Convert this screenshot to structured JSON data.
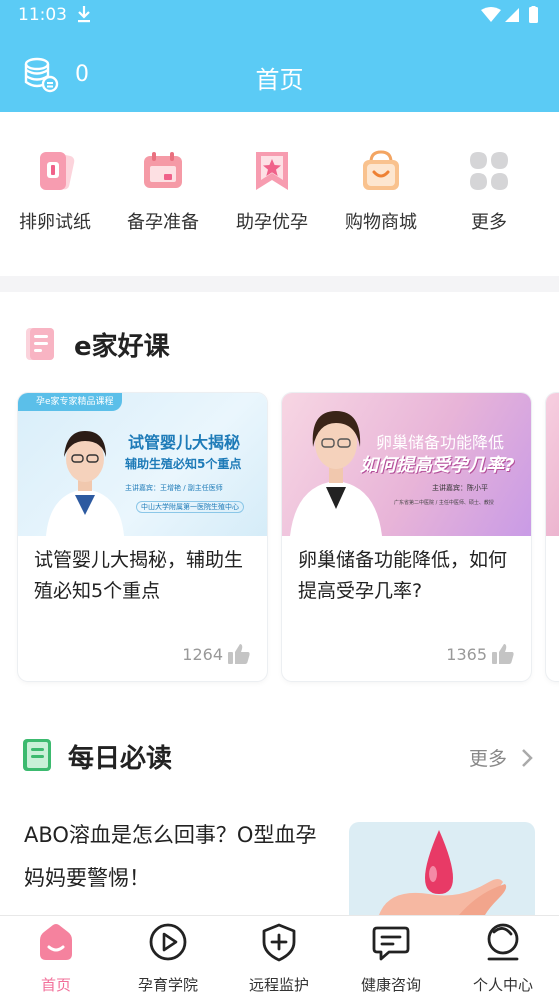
{
  "status_bar": {
    "time": "11:03"
  },
  "header": {
    "coin_count": "0",
    "title": "首页"
  },
  "quick_menu": [
    {
      "label": "排卵试纸",
      "icon": "ovulation-strip-icon"
    },
    {
      "label": "备孕准备",
      "icon": "calendar-icon"
    },
    {
      "label": "助孕优孕",
      "icon": "star-ribbon-icon"
    },
    {
      "label": "购物商城",
      "icon": "shopping-bag-icon"
    },
    {
      "label": "更多",
      "icon": "more-grid-icon"
    }
  ],
  "course_section": {
    "title": "e家好课",
    "cards": [
      {
        "badge": "孕e家专家精品课程",
        "banner_title": "试管婴儿大揭秘",
        "banner_sub": "辅助生殖必知5个重点",
        "banner_host": "主讲嘉宾：王增艳 / 副主任医师",
        "banner_org": "中山大学附属第一医院生殖中心",
        "title": "试管婴儿大揭秘，辅助生殖必知5个重点",
        "likes": "1264"
      },
      {
        "banner_title": "卵巢储备功能降低",
        "banner_sub": "如何提高受孕几率?",
        "banner_host": "主讲嘉宾：陈小平",
        "banner_org": "广东省第二中医院 / 主任中医师、硕士、教授",
        "title": "卵巢储备功能降低，如何提高受孕几率?",
        "likes": "1365"
      }
    ]
  },
  "daily_section": {
    "title": "每日必读",
    "more_label": "更多",
    "article_title": "ABO溶血是怎么回事？O型血孕妈妈要警惕！"
  },
  "bottom_nav": [
    {
      "label": "首页",
      "icon": "home-icon",
      "active": true
    },
    {
      "label": "孕育学院",
      "icon": "play-circle-icon",
      "active": false
    },
    {
      "label": "远程监护",
      "icon": "shield-plus-icon",
      "active": false
    },
    {
      "label": "健康咨询",
      "icon": "chat-bubble-icon",
      "active": false
    },
    {
      "label": "个人中心",
      "icon": "profile-circle-icon",
      "active": false
    }
  ],
  "colors": {
    "brand": "#5bcbf5",
    "accent": "#f2709a"
  }
}
